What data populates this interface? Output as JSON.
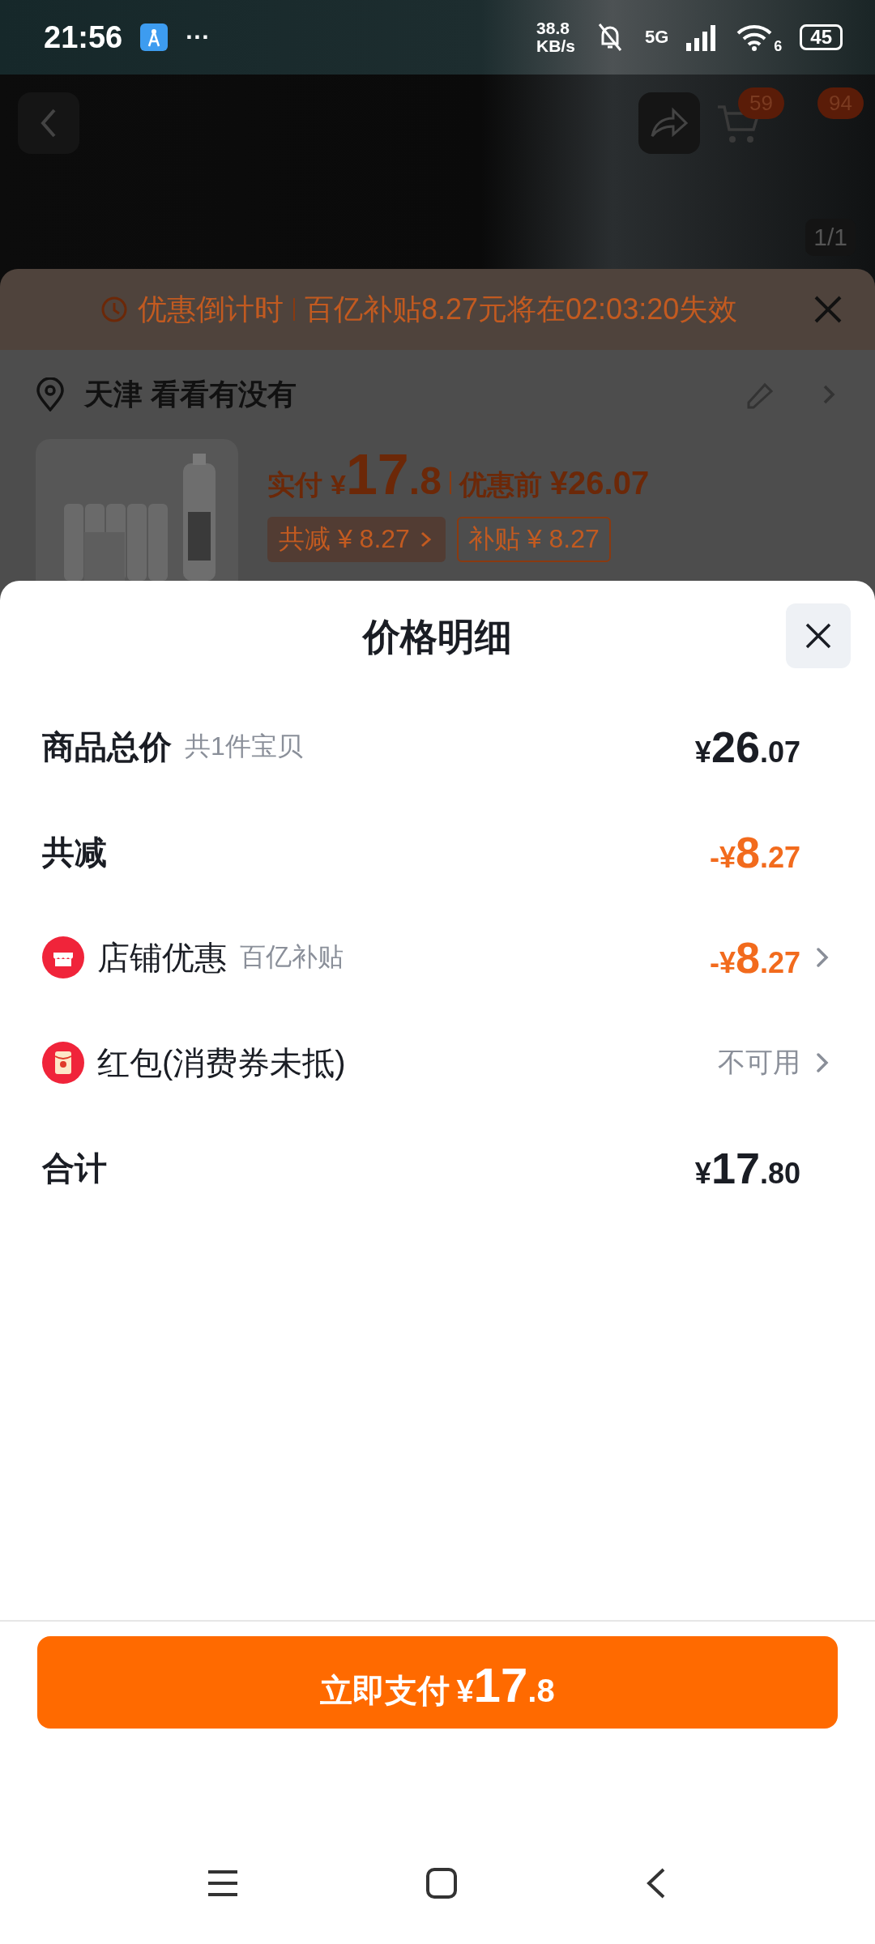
{
  "status_bar": {
    "time": "21:56",
    "more": "···",
    "speed_value": "38.8",
    "speed_unit": "KB/s",
    "network": "5G",
    "wifi_band": "6",
    "battery": "45"
  },
  "product_header": {
    "cart_badge": "59",
    "more_badge": "94",
    "image_counter": "1/1"
  },
  "countdown": {
    "label": "优惠倒计时",
    "message": "百亿补贴8.27元将在02:03:20失效"
  },
  "address": {
    "text": "天津 看看有没有"
  },
  "price_summary": {
    "paid_label": "实付",
    "paid_symbol": "¥",
    "paid_whole": "17",
    "paid_cents": ".8",
    "before_label": "优惠前",
    "before_amount": "¥26.07",
    "tags": [
      {
        "text": "共减 ¥ 8.27",
        "kind": "filled",
        "has_arrow": true
      },
      {
        "text": "补贴 ¥ 8.27",
        "kind": "outlined",
        "has_arrow": false
      }
    ]
  },
  "sheet": {
    "title": "价格明细",
    "rows": [
      {
        "kind": "plain",
        "label": "商品总价",
        "note": "共1件宝贝",
        "discount": false,
        "prefix": "¥",
        "whole": "26",
        "cents": ".07",
        "has_arrow": false
      },
      {
        "kind": "plain",
        "label": "共减",
        "discount": true,
        "prefix": "-¥",
        "whole": "8",
        "cents": ".27",
        "has_arrow": false
      },
      {
        "kind": "shop",
        "label": "店铺优惠",
        "note": "百亿补贴",
        "discount": true,
        "prefix": "-¥",
        "whole": "8",
        "cents": ".27",
        "has_arrow": true
      },
      {
        "kind": "redpacket",
        "label": "红包(消费券未抵)",
        "value_text": "不可用",
        "has_arrow": true
      },
      {
        "kind": "plain",
        "label": "合计",
        "discount": false,
        "prefix": "¥",
        "whole": "17",
        "cents": ".80",
        "has_arrow": false
      }
    ]
  },
  "pay_button": {
    "label": "立即支付",
    "symbol": "¥",
    "whole": "17",
    "cents": ".8"
  }
}
